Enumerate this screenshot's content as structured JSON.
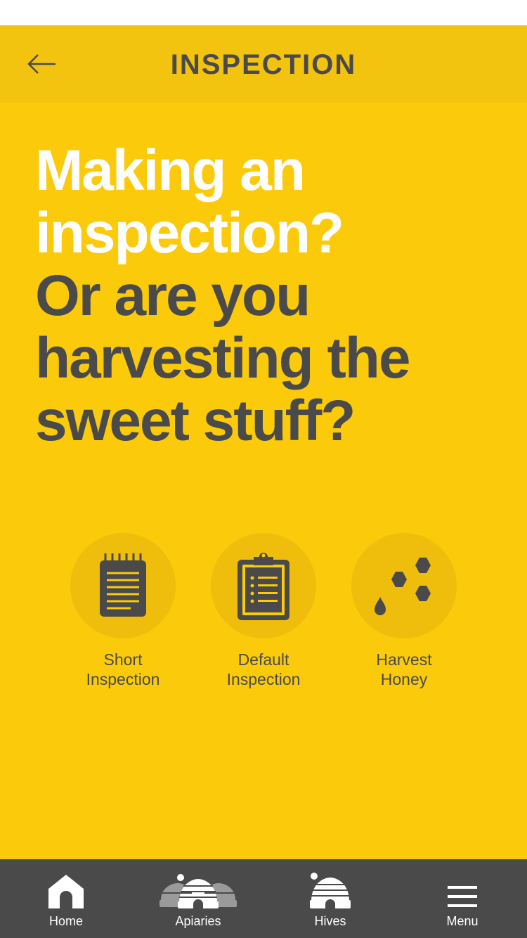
{
  "header": {
    "title": "INSPECTION",
    "back_icon": "arrow-left-icon"
  },
  "headline": {
    "lines_white": [
      "Making an",
      "inspection?"
    ],
    "lines_dark": [
      "Or are you",
      "harvesting the",
      "sweet stuff?"
    ]
  },
  "options": [
    {
      "label_line1": "Short",
      "label_line2": "Inspection",
      "icon": "notepad-icon"
    },
    {
      "label_line1": "Default",
      "label_line2": "Inspection",
      "icon": "clipboard-icon"
    },
    {
      "label_line1": "Harvest",
      "label_line2": "Honey",
      "icon": "honeycomb-icon"
    }
  ],
  "tabbar": {
    "tabs": [
      {
        "label": "Home",
        "icon": "home-icon"
      },
      {
        "label": "Apiaries",
        "icon": "apiaries-icon"
      },
      {
        "label": "Hives",
        "icon": "hive-icon"
      },
      {
        "label": "Menu",
        "icon": "menu-icon"
      }
    ]
  },
  "colors": {
    "header_bg": "#f2c30f",
    "main_bg": "#fbca0a",
    "circle_bg": "#efbd0b",
    "dark_text": "#4a4a4a",
    "tabbar_bg": "#4a4a4a"
  }
}
